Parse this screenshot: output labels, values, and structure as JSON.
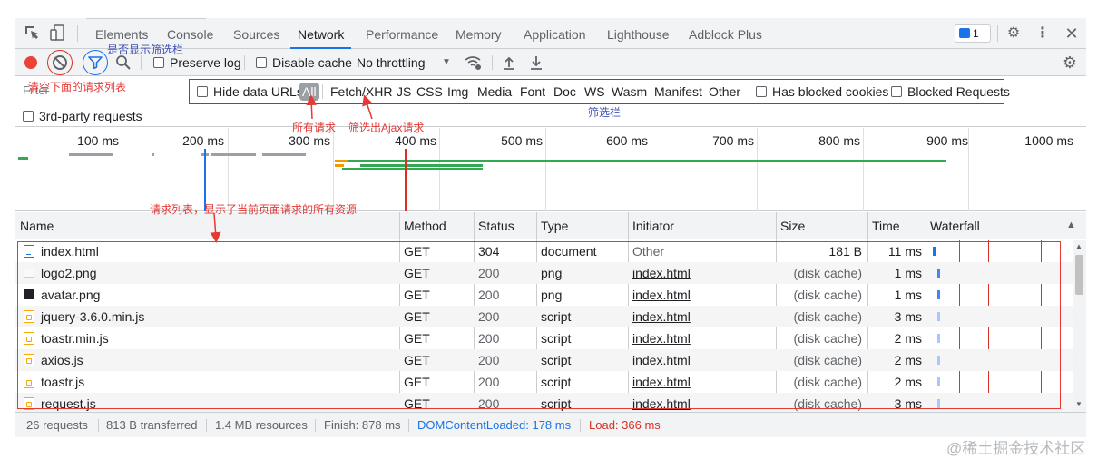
{
  "tabs": [
    "Elements",
    "Console",
    "Sources",
    "Network",
    "Performance",
    "Memory",
    "Application",
    "Lighthouse",
    "Adblock Plus"
  ],
  "active_tab": "Network",
  "issues_count": "1",
  "toolbar": {
    "preserve_log": "Preserve log",
    "disable_cache": "Disable cache",
    "throttling": "No throttling"
  },
  "filter": {
    "placeholder": "Filter",
    "hide_data_urls": "Hide data URLs",
    "types": [
      "All",
      "Fetch/XHR",
      "JS",
      "CSS",
      "Img",
      "Media",
      "Font",
      "Doc",
      "WS",
      "Wasm",
      "Manifest",
      "Other"
    ],
    "has_blocked_cookies": "Has blocked cookies",
    "blocked_requests": "Blocked Requests",
    "third_party": "3rd-party requests"
  },
  "overview": {
    "ticks": [
      "100 ms",
      "200 ms",
      "300 ms",
      "400 ms",
      "500 ms",
      "600 ms",
      "700 ms",
      "800 ms",
      "900 ms",
      "1000 ms"
    ]
  },
  "columns": [
    "Name",
    "Method",
    "Status",
    "Type",
    "Initiator",
    "Size",
    "Time",
    "Waterfall"
  ],
  "requests": [
    {
      "name": "index.html",
      "icon": "document-icon",
      "method": "GET",
      "status": "304",
      "type": "document",
      "initiator": "Other",
      "size": "181 B",
      "time": "11 ms"
    },
    {
      "name": "logo2.png",
      "icon": "image-icon",
      "method": "GET",
      "status": "200",
      "type": "png",
      "initiator": "index.html",
      "size": "(disk cache)",
      "time": "1 ms"
    },
    {
      "name": "avatar.png",
      "icon": "image-icon",
      "method": "GET",
      "status": "200",
      "type": "png",
      "initiator": "index.html",
      "size": "(disk cache)",
      "time": "1 ms"
    },
    {
      "name": "jquery-3.6.0.min.js",
      "icon": "script-icon",
      "method": "GET",
      "status": "200",
      "type": "script",
      "initiator": "index.html",
      "size": "(disk cache)",
      "time": "3 ms"
    },
    {
      "name": "toastr.min.js",
      "icon": "script-icon",
      "method": "GET",
      "status": "200",
      "type": "script",
      "initiator": "index.html",
      "size": "(disk cache)",
      "time": "2 ms"
    },
    {
      "name": "axios.js",
      "icon": "script-icon",
      "method": "GET",
      "status": "200",
      "type": "script",
      "initiator": "index.html",
      "size": "(disk cache)",
      "time": "2 ms"
    },
    {
      "name": "toastr.js",
      "icon": "script-icon",
      "method": "GET",
      "status": "200",
      "type": "script",
      "initiator": "index.html",
      "size": "(disk cache)",
      "time": "2 ms"
    },
    {
      "name": "request.js",
      "icon": "script-icon",
      "method": "GET",
      "status": "200",
      "type": "script",
      "initiator": "index.html",
      "size": "(disk cache)",
      "time": "3 ms"
    }
  ],
  "status": {
    "requests": "26 requests",
    "transferred": "813 B transferred",
    "resources": "1.4 MB resources",
    "finish": "Finish: 878 ms",
    "dcl": "DOMContentLoaded: 178 ms",
    "load": "Load: 366 ms"
  },
  "annotations": {
    "filter_toggle": "是否显示筛选栏",
    "clear_list": "清空下面的请求列表",
    "filter_bar": "筛选栏",
    "all_requests": "所有请求",
    "ajax_filter": "筛选出Ajax请求",
    "request_list": "请求列表，显示了当前页面请求的所有资源"
  },
  "watermark": "@稀土掘金技术社区",
  "colors": {
    "accent": "#1a73e8",
    "record": "#ea4335",
    "annotation_red": "#e53935",
    "annotation_blue": "#3f51b5"
  }
}
